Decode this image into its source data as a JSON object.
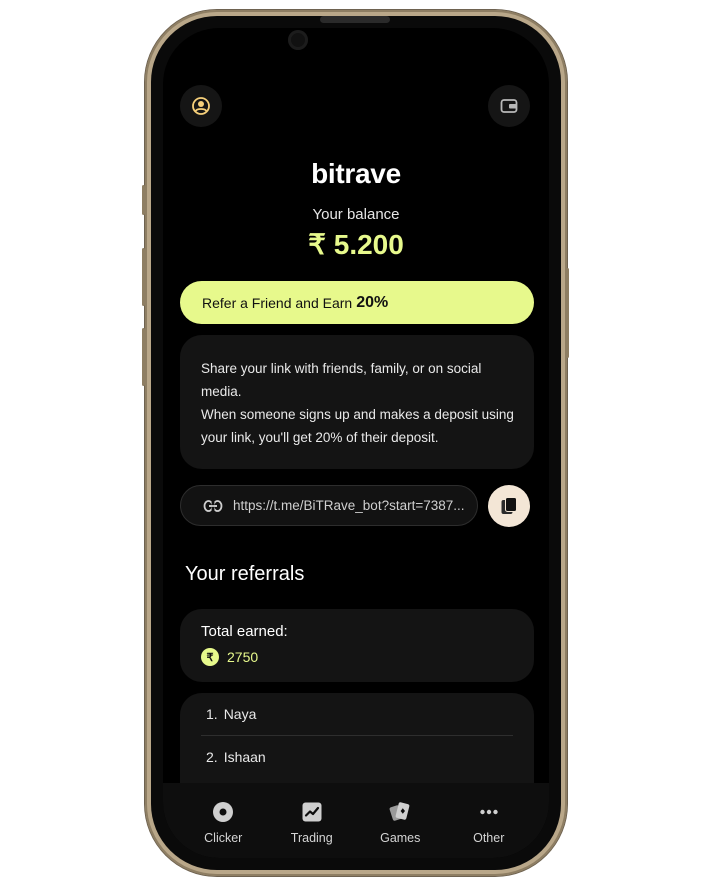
{
  "app": {
    "brand": "bitrave",
    "balance_label": "Your balance",
    "balance_value": "₹ 5.200",
    "accent_color": "#e7f98c"
  },
  "header": {
    "left_icon": "profile-icon",
    "right_icon": "wallet-icon"
  },
  "referral": {
    "banner_text": "Refer a Friend and Earn",
    "banner_percent": "20%",
    "info_paragraph_1": "Share your link with friends, family, or on social media.",
    "info_paragraph_2": "When someone signs up and makes a deposit using your link, you'll get 20% of their deposit.",
    "link": "https://t.me/BiTRave_bot?start=7387...",
    "link_icon": "link-icon",
    "copy_icon": "copy-icon"
  },
  "referrals": {
    "title": "Your referrals",
    "total_label": "Total earned:",
    "total_currency": "₹",
    "total_value": "2750",
    "items": [
      {
        "num": "1.",
        "name": "Naya"
      },
      {
        "num": "2.",
        "name": "Ishaan"
      }
    ]
  },
  "nav": {
    "items": [
      {
        "label": "Clicker",
        "icon": "clicker-icon"
      },
      {
        "label": "Trading",
        "icon": "chart-icon"
      },
      {
        "label": "Games",
        "icon": "cards-icon"
      },
      {
        "label": "Other",
        "icon": "more-icon"
      }
    ]
  }
}
